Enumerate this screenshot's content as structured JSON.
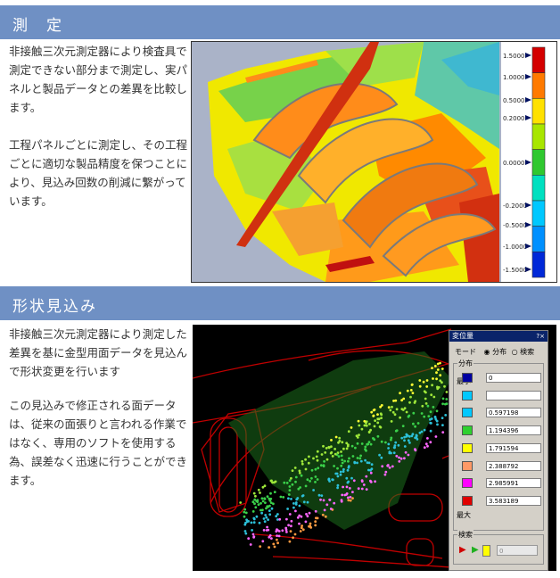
{
  "section1": {
    "heading": "測　定",
    "paragraph1": "非接触三次元測定器により検査具で測定できない部分まで測定し、実パネルと製品データとの差異を比較します。",
    "paragraph2": "工程パネルごとに測定し、その工程ごとに適切な製品精度を保つことにより、見込み回数の削減に繋がっています。",
    "scale_labels": [
      "1.5000",
      "1.0000",
      "0.5000",
      "0.2000",
      "0.0000",
      "-0.2000",
      "-0.5000",
      "-1.0000",
      "-1.5000"
    ],
    "scale_colors": [
      "#d40000",
      "#ff7a00",
      "#ffe100",
      "#a8e600",
      "#2fc82f",
      "#00e0c0",
      "#00c8ff",
      "#0090ff",
      "#0028d8"
    ]
  },
  "section2": {
    "heading": "形状見込み",
    "paragraph1": "非接触三次元測定器により測定した差異を基に金型用面データを見込んで形状変更を行います",
    "paragraph2": "この見込みで修正される面データは、従来の面張りと言われる作業ではなく、専用のソフトを使用する為、誤差なく迅速に行うことができます。"
  },
  "panel": {
    "title": "変位量",
    "mode_label": "モード",
    "mode_option_distribution": "分布",
    "mode_option_search": "検索",
    "distribution_label": "分布",
    "min_label": "最小",
    "max_label": "最大",
    "min_value": "0",
    "values": [
      "",
      "0.597198",
      "1.194396",
      "1.791594",
      "2.388792",
      "2.985991",
      "3.583189"
    ],
    "swatch_colors": [
      "#0000a0",
      "#00c8ff",
      "#00c8ff",
      "#2fd02f",
      "#ffff00",
      "#ff9966",
      "#ff00ff",
      "#e00000"
    ],
    "search_label": "検索",
    "search_value": "0"
  }
}
